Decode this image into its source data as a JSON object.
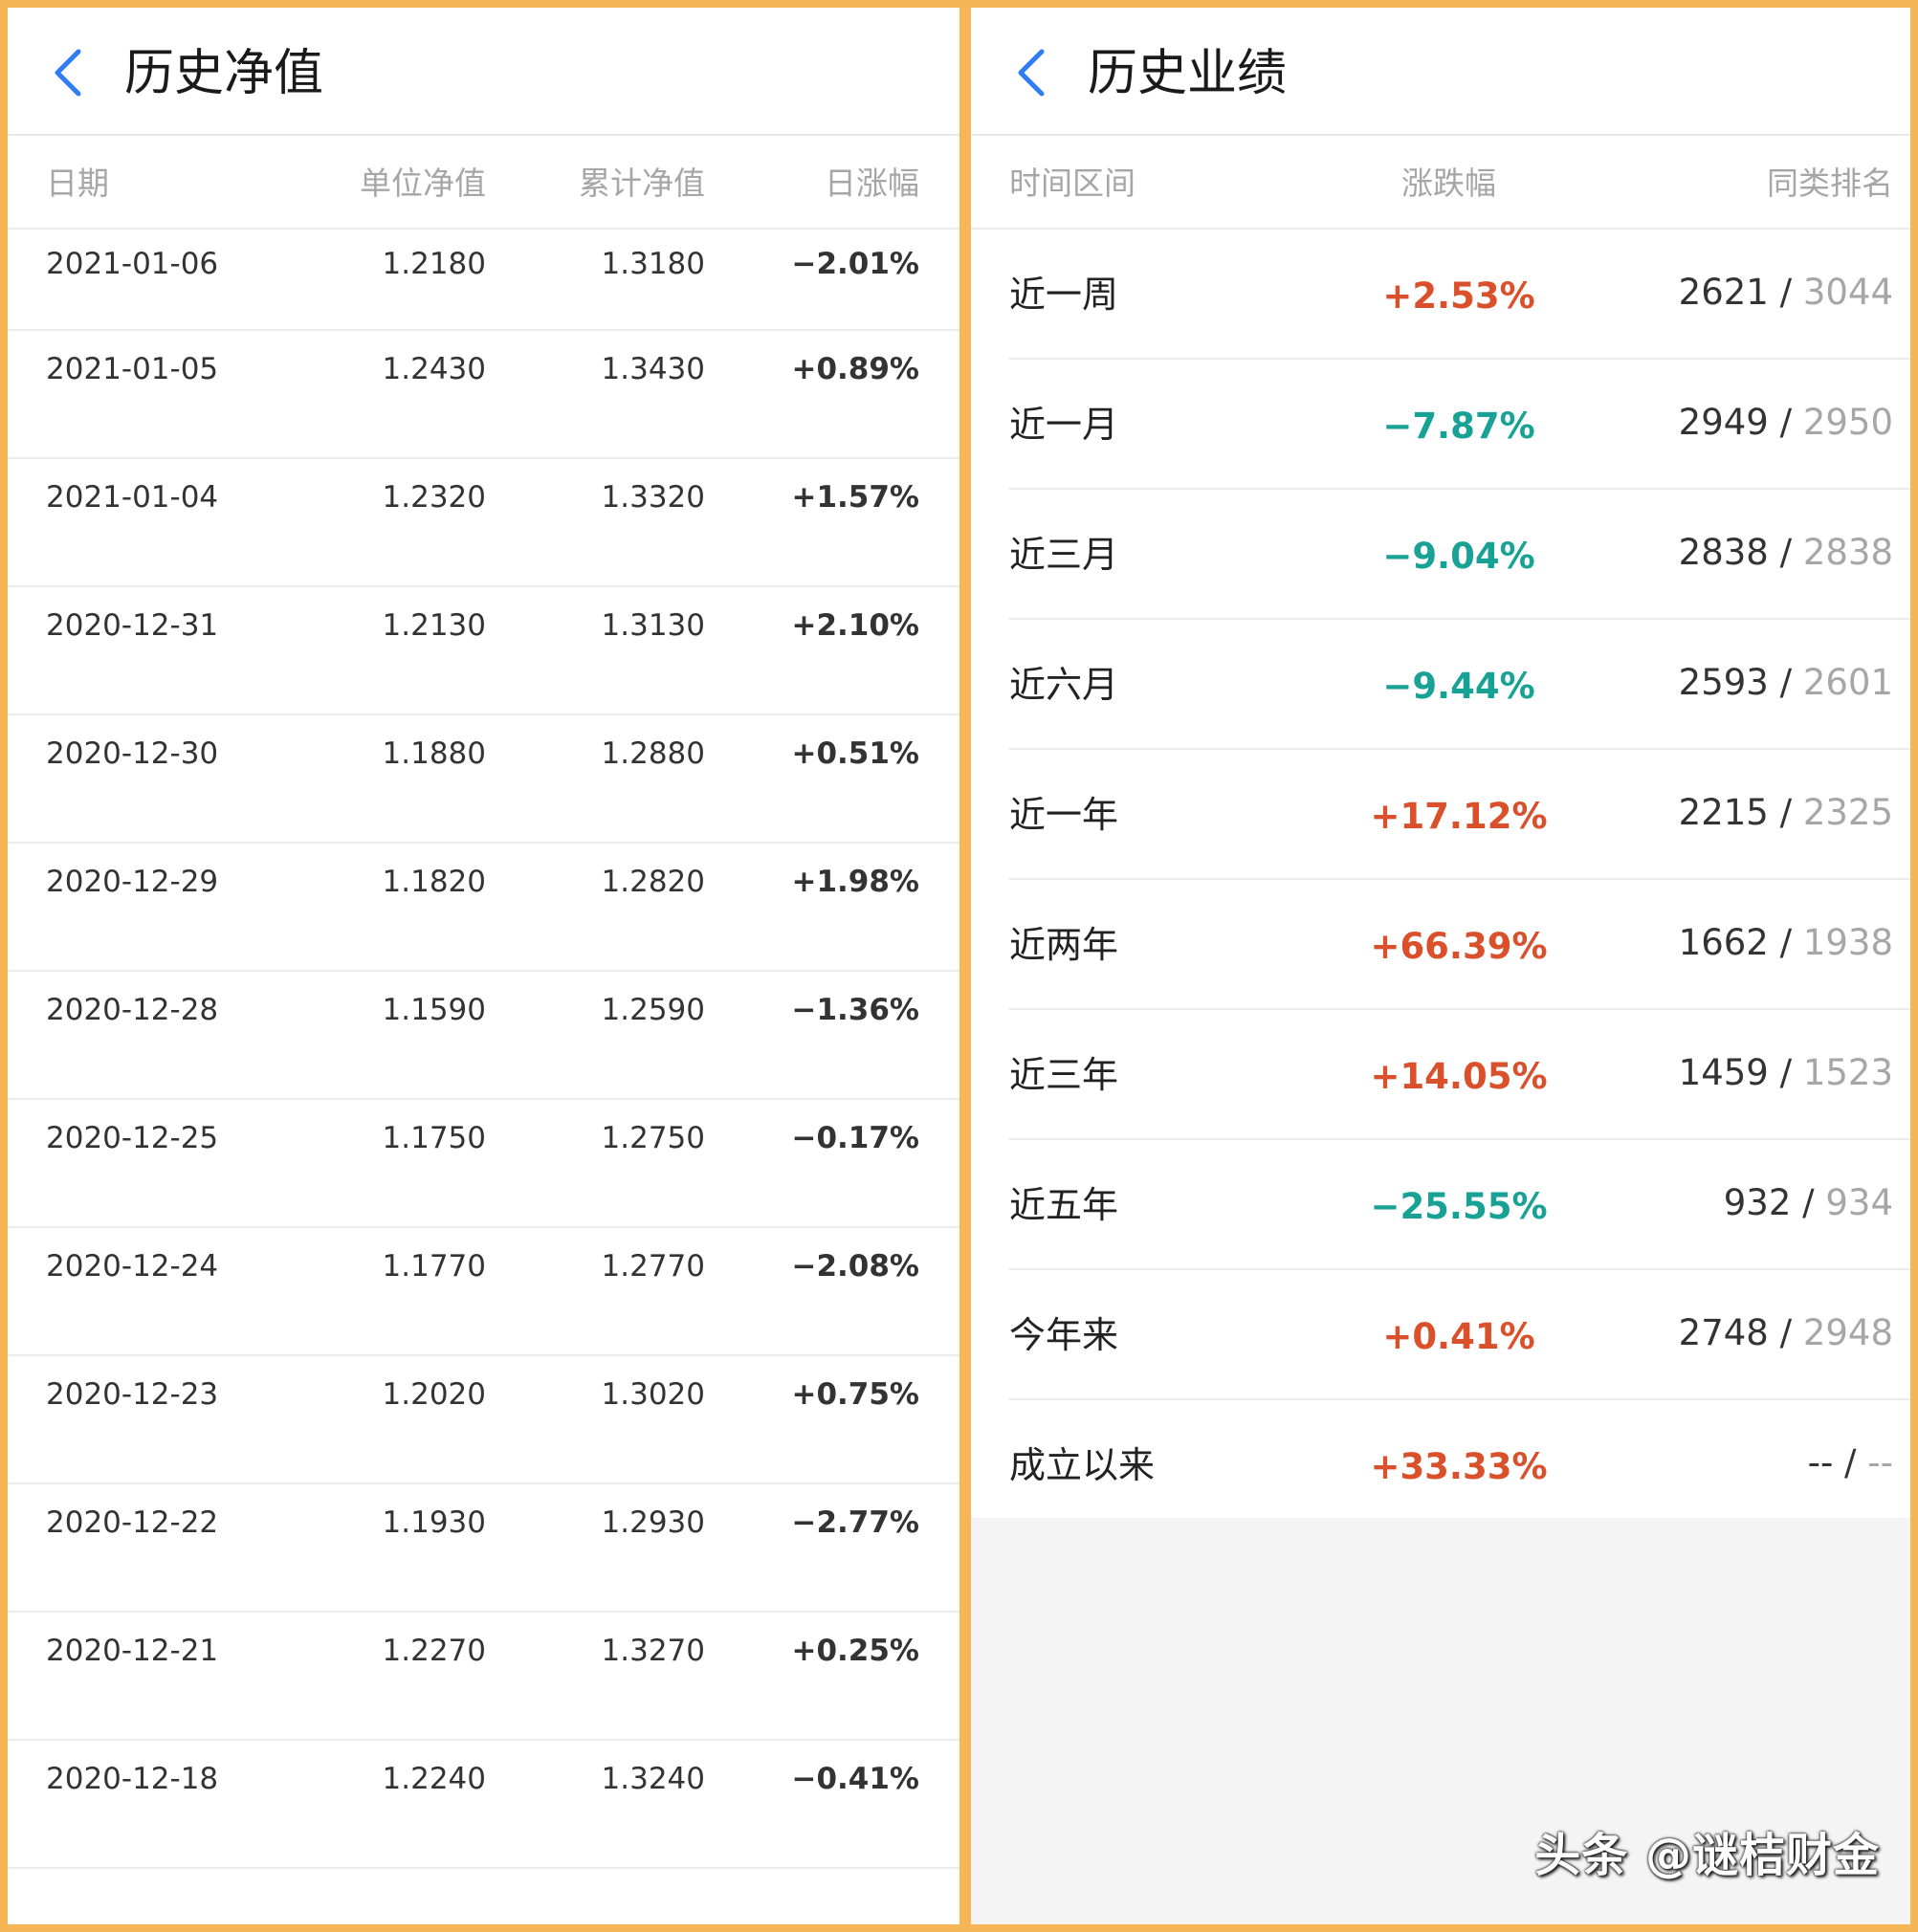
{
  "colors": {
    "frame": "#f6b655",
    "positive": "#d9502a",
    "negative": "#17a295",
    "accent": "#2f7df6",
    "muted": "#a6a6a6"
  },
  "left": {
    "back_icon": "chevron-left-icon",
    "title": "历史净值",
    "headers": {
      "date": "日期",
      "unit_nav": "单位净值",
      "acc_nav": "累计净值",
      "daily_change": "日涨幅"
    },
    "rows": [
      {
        "date": "2021-01-06",
        "unit": "1.2180",
        "acc": "1.3180",
        "change": "−2.01%",
        "dir": "neg"
      },
      {
        "date": "2021-01-05",
        "unit": "1.2430",
        "acc": "1.3430",
        "change": "+0.89%",
        "dir": "pos"
      },
      {
        "date": "2021-01-04",
        "unit": "1.2320",
        "acc": "1.3320",
        "change": "+1.57%",
        "dir": "pos"
      },
      {
        "date": "2020-12-31",
        "unit": "1.2130",
        "acc": "1.3130",
        "change": "+2.10%",
        "dir": "pos"
      },
      {
        "date": "2020-12-30",
        "unit": "1.1880",
        "acc": "1.2880",
        "change": "+0.51%",
        "dir": "pos"
      },
      {
        "date": "2020-12-29",
        "unit": "1.1820",
        "acc": "1.2820",
        "change": "+1.98%",
        "dir": "pos"
      },
      {
        "date": "2020-12-28",
        "unit": "1.1590",
        "acc": "1.2590",
        "change": "−1.36%",
        "dir": "neg"
      },
      {
        "date": "2020-12-25",
        "unit": "1.1750",
        "acc": "1.2750",
        "change": "−0.17%",
        "dir": "neg"
      },
      {
        "date": "2020-12-24",
        "unit": "1.1770",
        "acc": "1.2770",
        "change": "−2.08%",
        "dir": "neg"
      },
      {
        "date": "2020-12-23",
        "unit": "1.2020",
        "acc": "1.3020",
        "change": "+0.75%",
        "dir": "pos"
      },
      {
        "date": "2020-12-22",
        "unit": "1.1930",
        "acc": "1.2930",
        "change": "−2.77%",
        "dir": "neg"
      },
      {
        "date": "2020-12-21",
        "unit": "1.2270",
        "acc": "1.3270",
        "change": "+0.25%",
        "dir": "pos"
      },
      {
        "date": "2020-12-18",
        "unit": "1.2240",
        "acc": "1.3240",
        "change": "−0.41%",
        "dir": "neg"
      }
    ]
  },
  "right": {
    "back_icon": "chevron-left-icon",
    "title": "历史业绩",
    "headers": {
      "period": "时间区间",
      "change": "涨跌幅",
      "rank": "同类排名"
    },
    "rows": [
      {
        "period": "近一周",
        "change": "+2.53%",
        "dir": "pos",
        "rank": "2621",
        "total": "3044"
      },
      {
        "period": "近一月",
        "change": "−7.87%",
        "dir": "neg",
        "rank": "2949",
        "total": "2950"
      },
      {
        "period": "近三月",
        "change": "−9.04%",
        "dir": "neg",
        "rank": "2838",
        "total": "2838"
      },
      {
        "period": "近六月",
        "change": "−9.44%",
        "dir": "neg",
        "rank": "2593",
        "total": "2601"
      },
      {
        "period": "近一年",
        "change": "+17.12%",
        "dir": "pos",
        "rank": "2215",
        "total": "2325"
      },
      {
        "period": "近两年",
        "change": "+66.39%",
        "dir": "pos",
        "rank": "1662",
        "total": "1938"
      },
      {
        "period": "近三年",
        "change": "+14.05%",
        "dir": "pos",
        "rank": "1459",
        "total": "1523"
      },
      {
        "period": "近五年",
        "change": "−25.55%",
        "dir": "neg",
        "rank": "932",
        "total": "934"
      },
      {
        "period": "今年来",
        "change": "+0.41%",
        "dir": "pos",
        "rank": "2748",
        "total": "2948"
      },
      {
        "period": "成立以来",
        "change": "+33.33%",
        "dir": "pos",
        "rank": "--",
        "total": "--"
      }
    ],
    "rank_separator": " / "
  },
  "watermark": "头条 @谜桔财金"
}
